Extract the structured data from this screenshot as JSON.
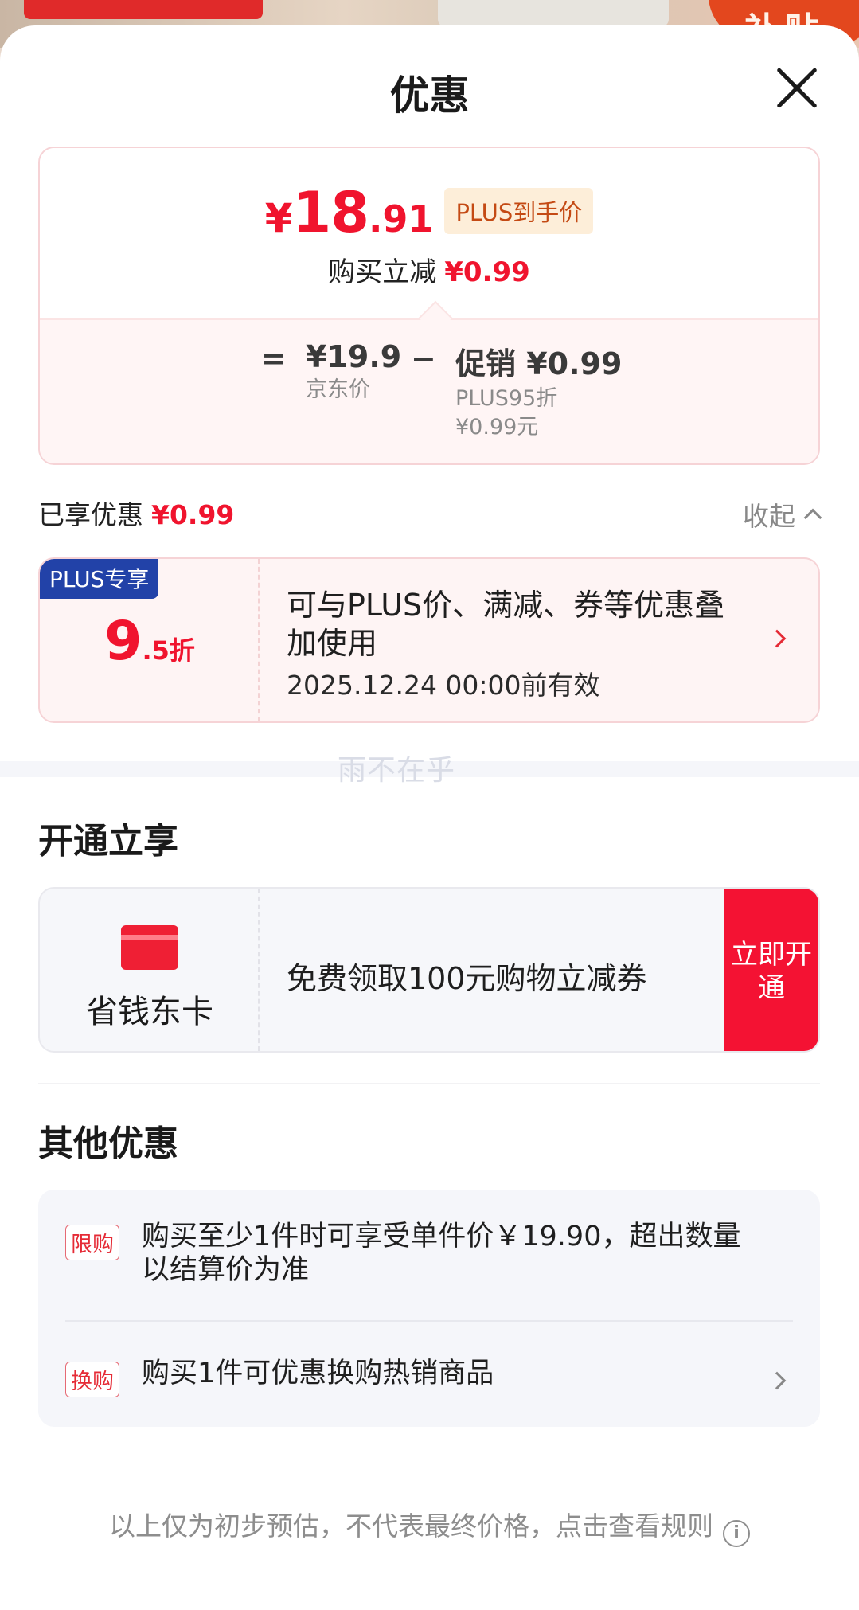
{
  "background": {
    "badge_text": "补贴"
  },
  "header": {
    "title": "优惠"
  },
  "price_card": {
    "yen": "¥",
    "integer": "18",
    "decimal": ".91",
    "plus_label": "PLUS到手价",
    "reduce_label": "购买立减",
    "reduce_value": "¥0.99",
    "equals": "=",
    "jd_price": "¥19.9",
    "jd_label": "京东价",
    "minus": "−",
    "promo_label": "促销 ¥0.99",
    "promo_sub1": "PLUS95折",
    "promo_sub2": "¥0.99元"
  },
  "enjoyed": {
    "label": "已享优惠",
    "value": "¥0.99",
    "collapse_label": "收起"
  },
  "plus_coupon": {
    "tag": "PLUS专享",
    "discount_num": "9",
    "discount_unit": ".5折",
    "description": "可与PLUS价、满减、券等优惠叠加使用",
    "valid_until": "2025.12.24 00:00前有效"
  },
  "watermark": "雨不在乎",
  "open_section": {
    "title": "开通立享",
    "card_name": "省钱东卡",
    "card_desc": "免费领取100元购物立减券",
    "button_label": "立即开通"
  },
  "other_section": {
    "title": "其他优惠",
    "items": [
      {
        "tag": "限购",
        "text": "购买至少1件时可享受单件价￥19.90，超出数量以结算价为准"
      },
      {
        "tag": "换购",
        "text": "购买1件可优惠换购热销商品"
      }
    ]
  },
  "footer": {
    "note": "以上仅为初步预估，不代表最终价格，点击查看规则",
    "info_icon": "i"
  },
  "colors": {
    "accent_red": "#f0142e",
    "plus_blue": "#2242a8",
    "promo_bg": "#fef4f4"
  }
}
